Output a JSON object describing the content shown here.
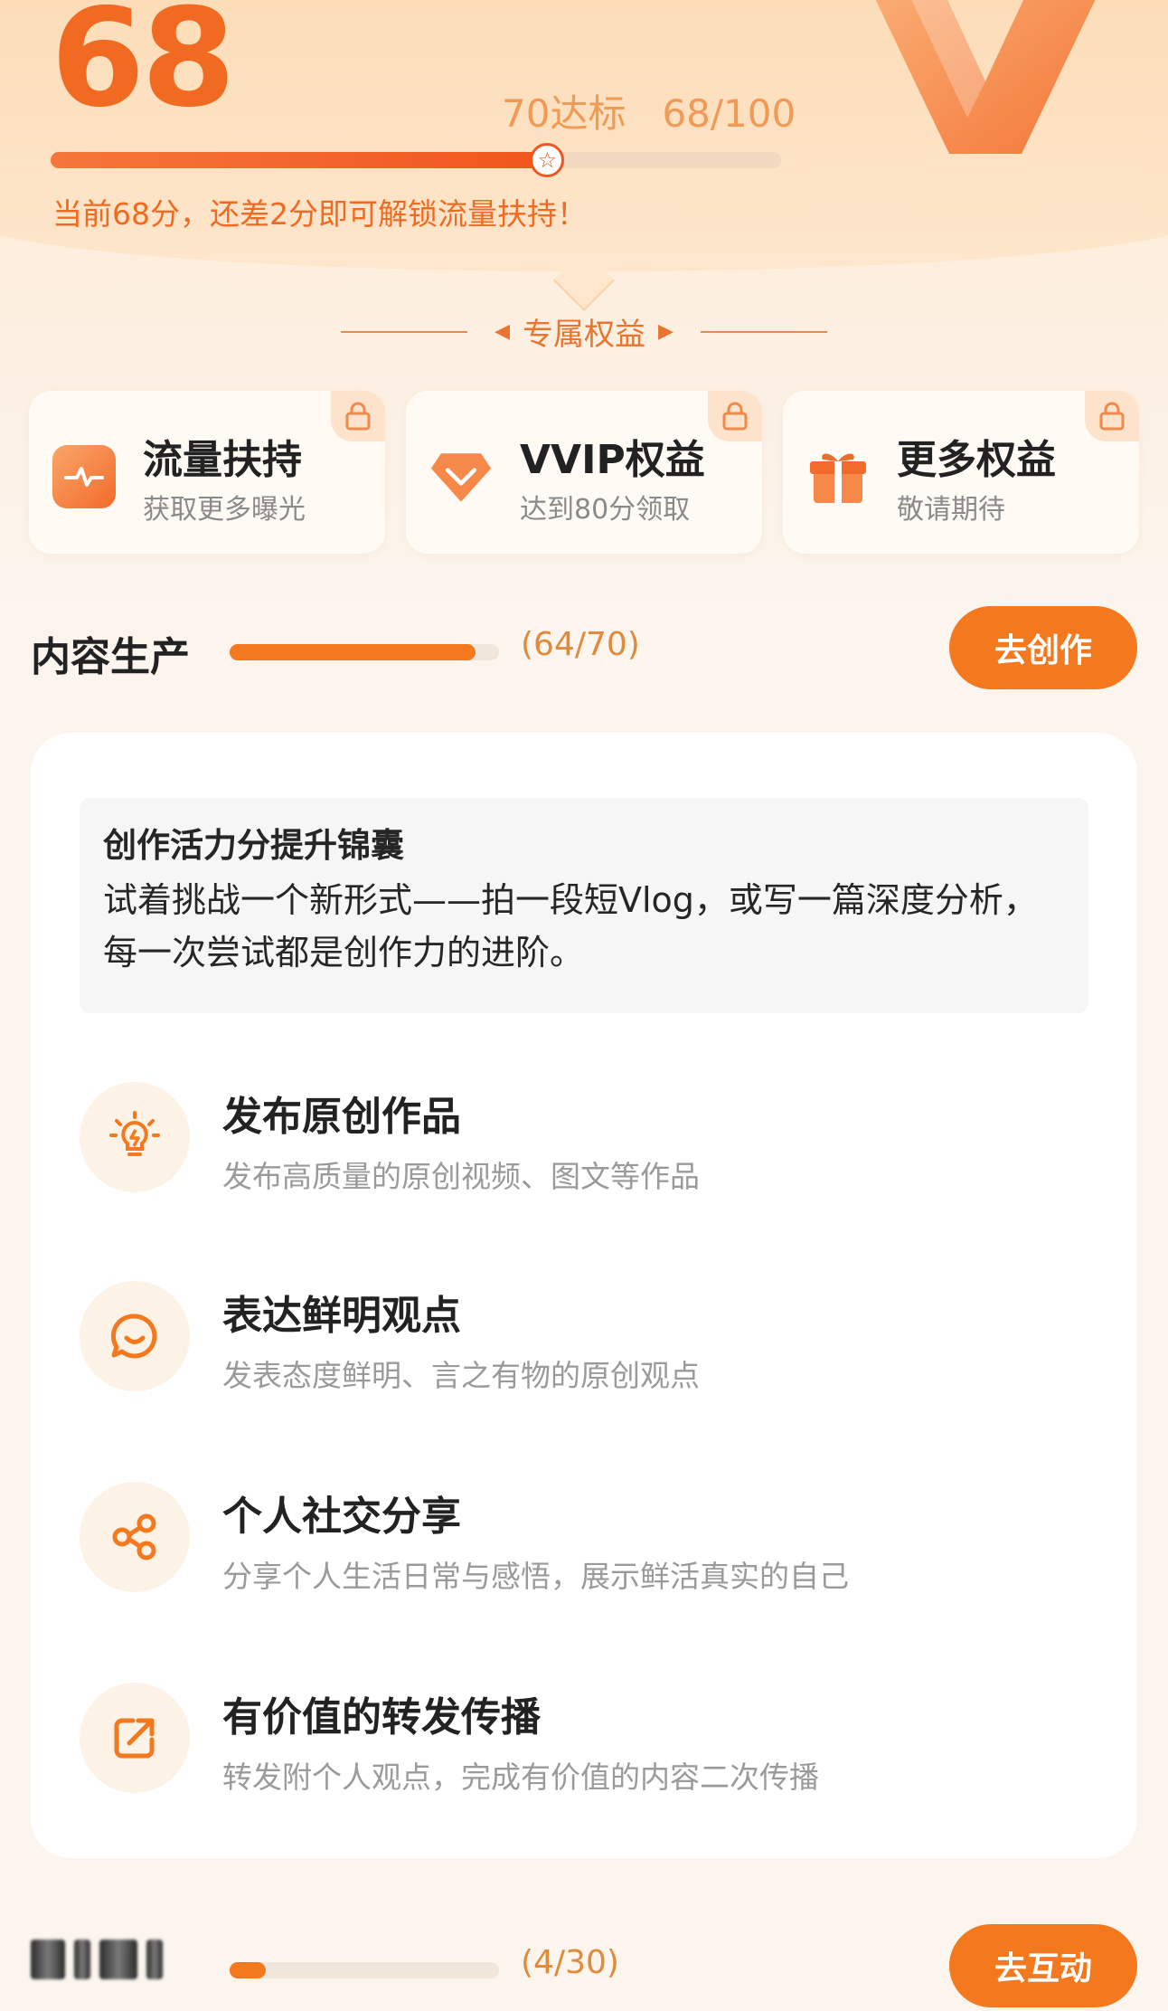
{
  "colors": {
    "accent": "#f3781e",
    "score": "#f06a22",
    "background": "#fbf5ee"
  },
  "score_panel": {
    "score": "68",
    "target_label": "70达标",
    "progress_label": "68/100",
    "progress_fraction": 0.68,
    "tip": "当前68分，还差2分即可解锁流量扶持！"
  },
  "perks_section": {
    "title": "专属权益",
    "items": [
      {
        "title": "流量扶持",
        "subtitle": "获取更多曝光",
        "icon": "pulse-icon"
      },
      {
        "title": "VVIP权益",
        "subtitle": "达到80分领取",
        "icon": "diamond-icon"
      },
      {
        "title": "更多权益",
        "subtitle": "敬请期待",
        "icon": "gift-icon"
      }
    ]
  },
  "content_production": {
    "label": "内容生产",
    "count": "(64/70)",
    "progress_fraction": 0.914,
    "button": "去创作"
  },
  "hint": {
    "title": "创作活力分提升锦囊",
    "body": "试着挑战一个新形式——拍一段短Vlog，或写一篇深度分析，每一次尝试都是创作力的进阶。"
  },
  "tasks": [
    {
      "title": "发布原创作品",
      "subtitle": "发布高质量的原创视频、图文等作品",
      "icon": "lightbulb-icon"
    },
    {
      "title": "表达鲜明观点",
      "subtitle": "发表态度鲜明、言之有物的原创观点",
      "icon": "chat-smile-icon"
    },
    {
      "title": "个人社交分享",
      "subtitle": "分享个人生活日常与感悟，展示鲜活真实的自己",
      "icon": "share-icon"
    },
    {
      "title": "有价值的转发传播",
      "subtitle": "转发附个人观点，完成有价值的内容二次传播",
      "icon": "forward-icon"
    }
  ],
  "interaction": {
    "count": "(4/30)",
    "progress_fraction": 0.133,
    "button": "去互动"
  }
}
